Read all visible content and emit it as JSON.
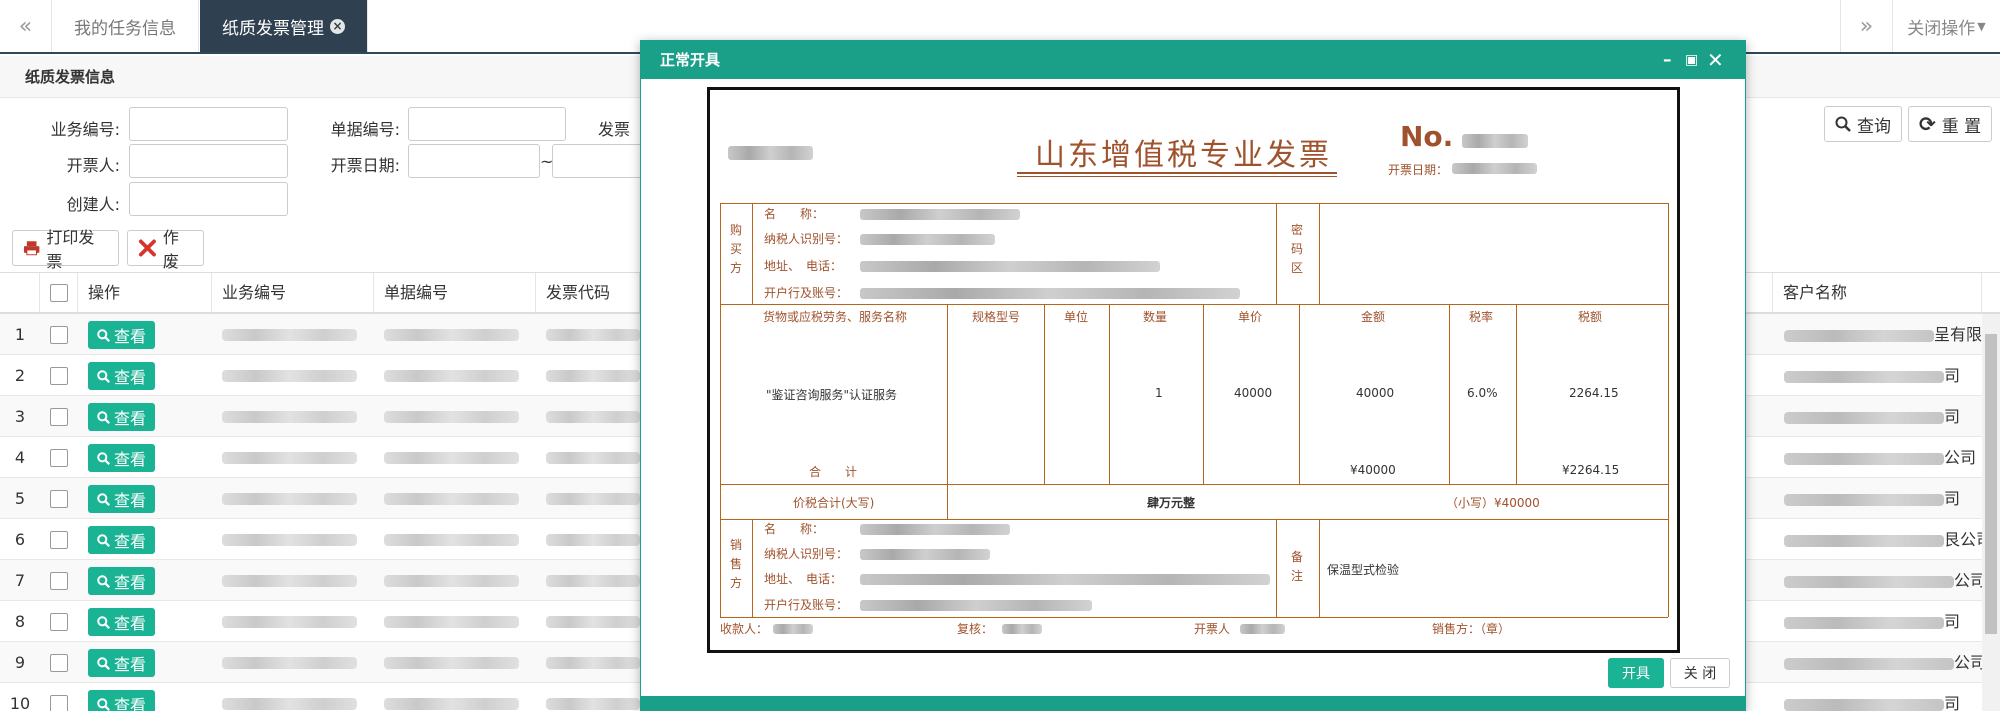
{
  "tabs": {
    "items": [
      {
        "label": "我的任务信息"
      },
      {
        "label": "纸质发票管理"
      }
    ],
    "close_ops_label": "关闭操作"
  },
  "panel": {
    "title": "纸质发票信息",
    "filters": {
      "biz_no_label": "业务编号:",
      "doc_no_label": "单据编号:",
      "invoice_label": "发票",
      "issuer_label": "开票人:",
      "issue_date_label": "开票日期:",
      "date_sep": "~",
      "creator_label": "创建人:"
    },
    "search_label": "查询",
    "reset_label": "重 置",
    "print_label": "打印发票",
    "void_label": "作废"
  },
  "table": {
    "headers": {
      "op": "操作",
      "biz_no": "业务编号",
      "doc_no": "单据编号",
      "invoice_code": "发票代码",
      "customer": "客户名称"
    },
    "view_label": "查看",
    "rows": [
      {
        "num": "1",
        "cust_tail": "呈有限公"
      },
      {
        "num": "2",
        "cust_tail": "司"
      },
      {
        "num": "3",
        "cust_tail": "司"
      },
      {
        "num": "4",
        "cust_tail": "公司"
      },
      {
        "num": "5",
        "cust_tail": "司"
      },
      {
        "num": "6",
        "cust_tail": "艮公司"
      },
      {
        "num": "7",
        "cust_tail": "公司"
      },
      {
        "num": "8",
        "cust_tail": "司"
      },
      {
        "num": "9",
        "cust_tail": "公司"
      },
      {
        "num": "10",
        "cust_tail": "司"
      }
    ]
  },
  "modal": {
    "title": "正常开具",
    "min_icon": "minimize-icon",
    "max_icon": "maximize-icon",
    "close_icon": "close-icon",
    "ok_label": "开具",
    "close_label": "关 闭"
  },
  "invoice": {
    "title": "山东增值税专业发票",
    "no_label": "No.",
    "date_label": "开票日期：",
    "buyer_side": "购买方",
    "cipher_side": "密码区",
    "seller_side": "销售方",
    "remark_side": "备注",
    "name_label": "名　　称：",
    "tax_id_label": "纳税人识别号：",
    "addr_label": "地址、　电话：",
    "bank_label": "开户行及账号：",
    "col_goods": "货物或应税劳务、服务名称",
    "col_spec": "规格型号",
    "col_unit": "单位",
    "col_qty": "数量",
    "col_price": "单价",
    "col_amount": "金额",
    "col_rate": "税率",
    "col_tax": "税额",
    "item_name": "\"鉴证咨询服务\"认证服务",
    "item_qty": "1",
    "item_price": "40000",
    "item_amount": "40000",
    "item_rate": "6.0%",
    "item_tax": "2264.15",
    "total_label": "合　　计",
    "total_amount": "¥40000",
    "total_tax": "¥2264.15",
    "grand_label": "价税合计(大写)",
    "grand_upper": "肆万元整",
    "grand_small": "（小写）¥40000",
    "remark_text": "保温型式检验",
    "payee_label": "收款人：",
    "reviewer_label": "复核：",
    "drawer_label": "开票人",
    "seller_label": "销售方：（章）"
  },
  "colors": {
    "accent": "#1ab394",
    "modal_header": "#1aa089",
    "active_tab": "#2f4050",
    "invoice_brown": "#a0522d"
  }
}
